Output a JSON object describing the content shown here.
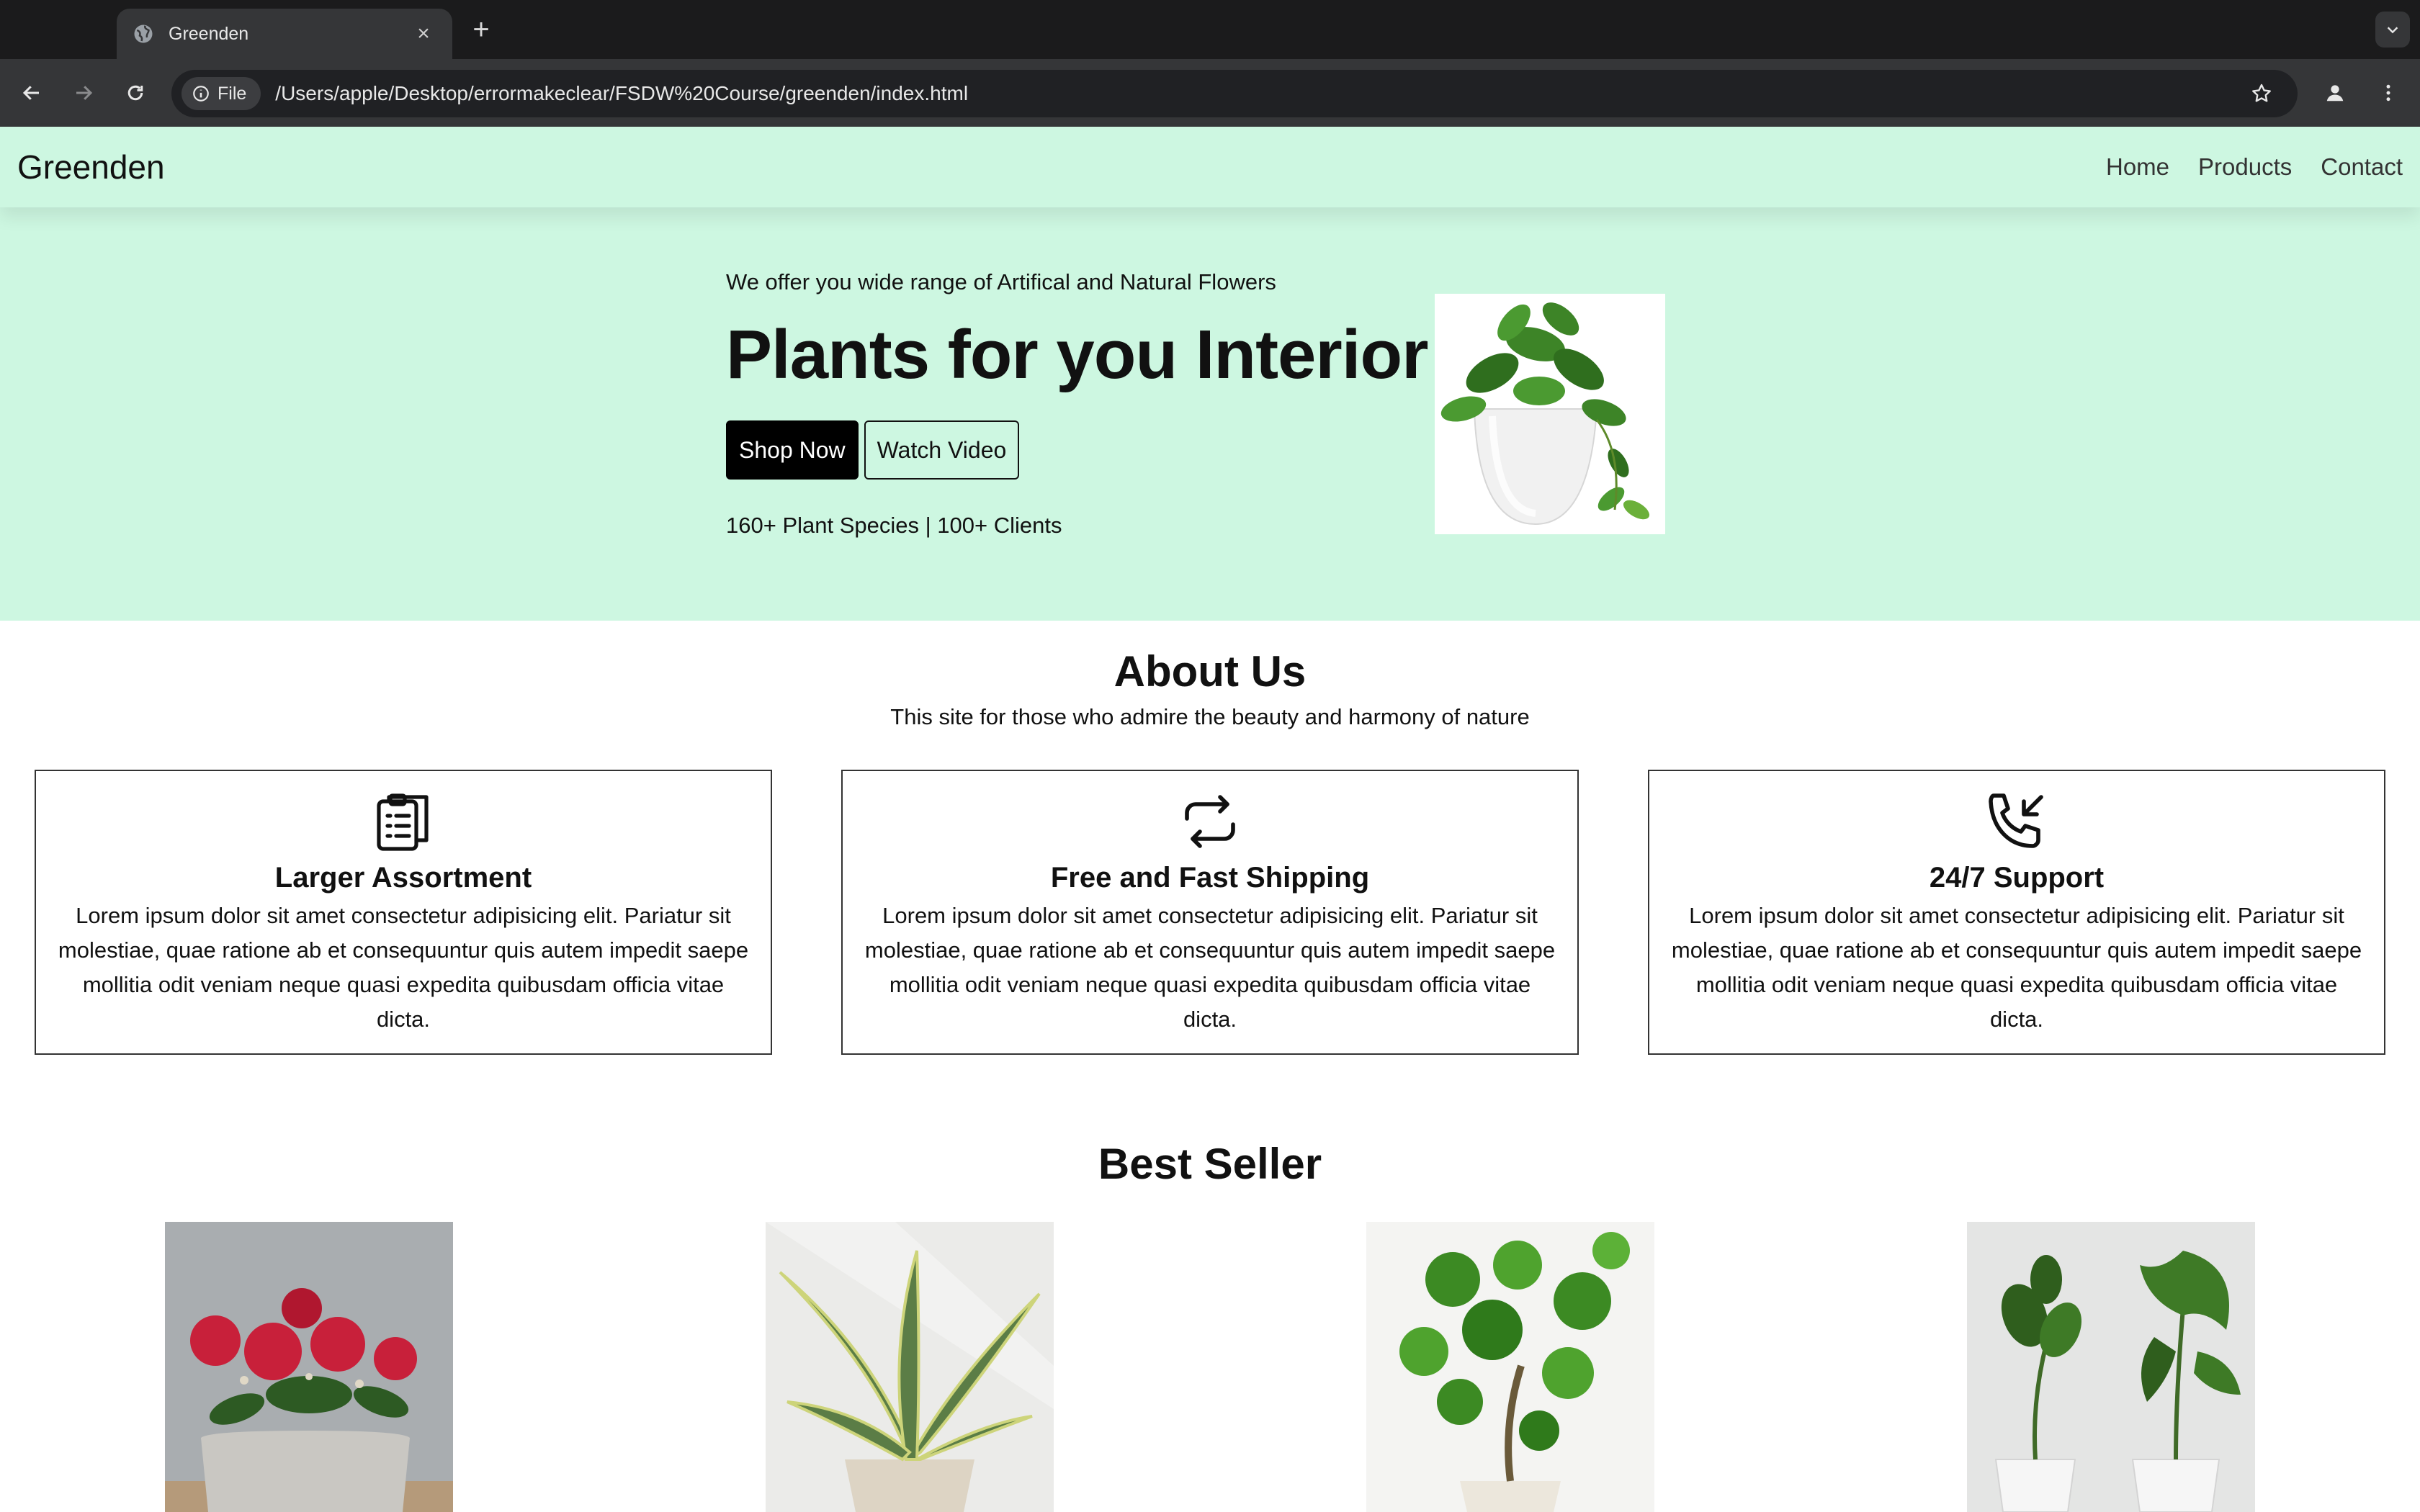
{
  "browser": {
    "tab_title": "Greenden",
    "file_chip": "File",
    "url": "/Users/apple/Desktop/errormakeclear/FSDW%20Course/greenden/index.html"
  },
  "nav": {
    "logo": "Greenden",
    "links": [
      "Home",
      "Products",
      "Contact"
    ]
  },
  "hero": {
    "tagline": "We offer you wide range of Artifical and Natural Flowers",
    "title": "Plants for you Interior",
    "primary_button": "Shop Now",
    "secondary_button": "Watch Video",
    "stats": "160+ Plant Species | 100+ Clients"
  },
  "about": {
    "title": "About Us",
    "subtitle": "This site for those who admire the beauty and harmony of nature",
    "cards": [
      {
        "icon": "clipboard-list-icon",
        "title": "Larger Assortment",
        "text": "Lorem ipsum dolor sit amet consectetur adipisicing elit. Pariatur sit molestiae, quae ratione ab et consequuntur quis autem impedit saepe mollitia odit veniam neque quasi expedita quibusdam officia vitae dicta."
      },
      {
        "icon": "refresh-icon",
        "title": "Free and Fast Shipping",
        "text": "Lorem ipsum dolor sit amet consectetur adipisicing elit. Pariatur sit molestiae, quae ratione ab et consequuntur quis autem impedit saepe mollitia odit veniam neque quasi expedita quibusdam officia vitae dicta."
      },
      {
        "icon": "phone-incoming-icon",
        "title": "24/7 Support",
        "text": "Lorem ipsum dolor sit amet consectetur adipisicing elit. Pariatur sit molestiae, quae ratione ab et consequuntur quis autem impedit saepe mollitia odit veniam neque quasi expedita quibusdam officia vitae dicta."
      }
    ]
  },
  "best_seller": {
    "title": "Best Seller"
  }
}
